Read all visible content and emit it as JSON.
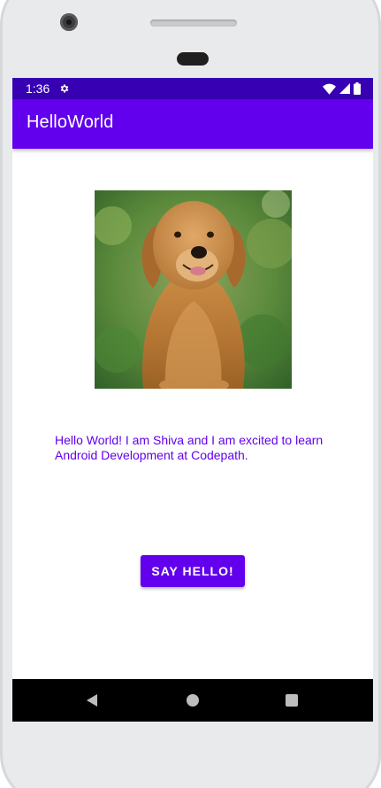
{
  "status_bar": {
    "time": "1:36",
    "icons": [
      "gear-icon",
      "wifi-icon",
      "signal-icon",
      "battery-icon"
    ],
    "background": "#3700b3",
    "foreground": "#ffffff"
  },
  "app_bar": {
    "title": "HelloWorld",
    "background": "#6200ee"
  },
  "main": {
    "image": {
      "icon": "dog-photo",
      "subject": "golden retriever"
    },
    "intro_text": "Hello World! I am Shiva and I am excited to learn Android Development at Codepath.",
    "intro_text_color": "#6200ee",
    "button": {
      "label": "SAY HELLO!",
      "background": "#6200ee",
      "text_color": "#ffffff"
    }
  },
  "nav_bar": {
    "icons": [
      "back-icon",
      "home-icon",
      "recents-icon"
    ],
    "background": "#000000",
    "icon_color": "#bdbdbd"
  },
  "device": {
    "frame_color": "#e9eaec"
  }
}
